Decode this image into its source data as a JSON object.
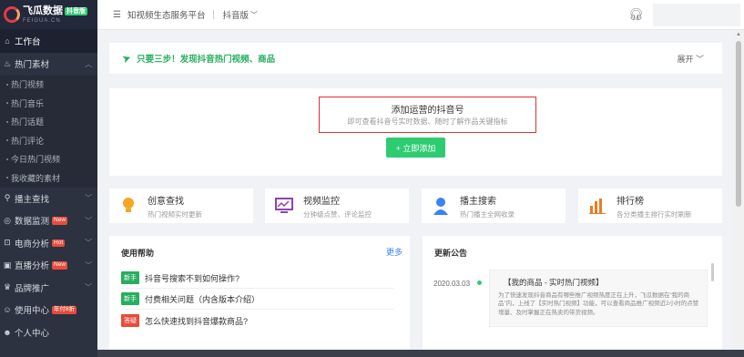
{
  "logo": {
    "title": "飞瓜数据",
    "badge": "抖音版",
    "sub": "FEIGUA.CN"
  },
  "sidebar": {
    "items": [
      {
        "label": "工作台",
        "icon": "home-icon",
        "active": true
      },
      {
        "label": "热门素材",
        "icon": "fire-icon"
      },
      {
        "label": "播主查找",
        "icon": "search-icon"
      },
      {
        "label": "数据监测",
        "icon": "monitor-icon",
        "tag": "New"
      },
      {
        "label": "电商分析",
        "icon": "cart-icon",
        "tag": "Hot"
      },
      {
        "label": "直播分析",
        "icon": "live-icon",
        "tag": "New"
      },
      {
        "label": "品牌推广",
        "icon": "brand-icon"
      },
      {
        "label": "使用中心",
        "icon": "user-center-icon",
        "tag": "年付8折"
      },
      {
        "label": "个人中心",
        "icon": "person-icon"
      }
    ],
    "subitems": [
      "热门视频",
      "热门音乐",
      "热门话题",
      "热门评论",
      "今日热门视频",
      "我收藏的素材"
    ]
  },
  "topbar": {
    "platform": "知视频生态服务平台",
    "version": "抖音版"
  },
  "notice": {
    "text": "只要三步！发现抖音热门视频、商品",
    "expand": "展开"
  },
  "add_account": {
    "title": "添加运营的抖音号",
    "subtitle": "即可查看抖音号实时数据、随时了解作品关键指标",
    "button": "+ 立即添加"
  },
  "features": [
    {
      "title": "创意查找",
      "subtitle": "热门视频实时更新",
      "icon": "bulb-icon",
      "color": "#f5a623"
    },
    {
      "title": "视频监控",
      "subtitle": "分钟级点赞、评论监控",
      "icon": "chart-monitor-icon",
      "color": "#8e44ad"
    },
    {
      "title": "播主搜索",
      "subtitle": "热门播主全网收录",
      "icon": "user-icon",
      "color": "#3b82f6"
    },
    {
      "title": "排行榜",
      "subtitle": "各分类播主排行实时刷新",
      "icon": "bar-chart-icon",
      "color": "#e67e22"
    }
  ],
  "help": {
    "title": "使用帮助",
    "more": "更多",
    "items": [
      {
        "badge": "新手",
        "badge_color": "#27ae60",
        "text": "抖音号搜索不到如何操作?"
      },
      {
        "badge": "新手",
        "badge_color": "#27ae60",
        "text": "付费相关问题（内含版本介绍）"
      },
      {
        "badge": "答疑",
        "badge_color": "#e74c3c",
        "text": "怎么快速找到抖音爆款商品?"
      }
    ]
  },
  "news": {
    "title": "更新公告",
    "date": "2020.03.03",
    "item_title": "【我的商品 - 实时热门视频】",
    "item_body": "为了快速发现抖音商品有哪些推广视频热度正在上升，飞瓜数据在“我的商品”内，上线了【实时热门视频】功能，可以查看商品推广视频近2小时的点赞增量、及时掌握正在热卖的带货视频。"
  }
}
